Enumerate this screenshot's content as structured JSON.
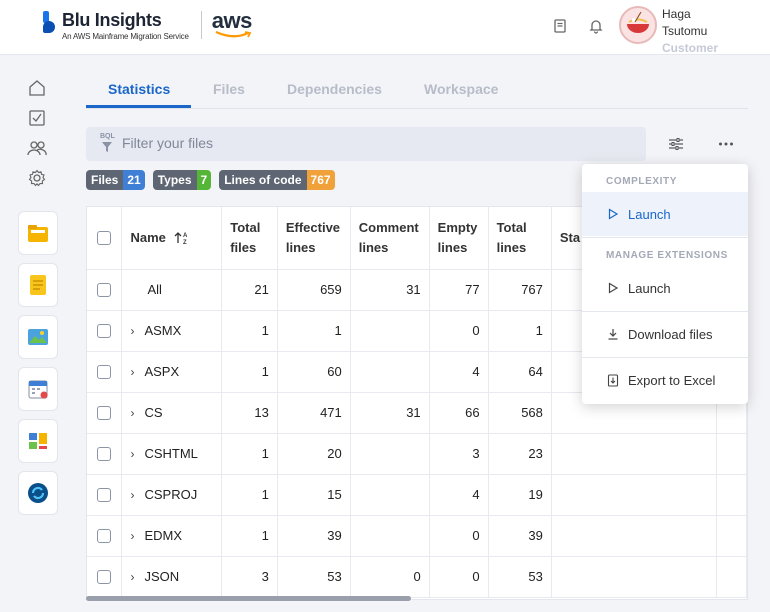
{
  "header": {
    "brand_title": "Blu Insights",
    "brand_subtitle": "An AWS Mainframe Migration Service",
    "aws_label": "aws",
    "user_first": "Haga",
    "user_last": "Tsutomu",
    "user_role": "Customer"
  },
  "tabs": [
    {
      "label": "Statistics",
      "active": true
    },
    {
      "label": "Files",
      "active": false
    },
    {
      "label": "Dependencies",
      "active": false
    },
    {
      "label": "Workspace",
      "active": false
    }
  ],
  "filter": {
    "tag": "BQL",
    "placeholder": "Filter your files"
  },
  "badges": [
    {
      "label": "Files",
      "count": "21",
      "color": "#3f7fd6"
    },
    {
      "label": "Types",
      "count": "7",
      "color": "#55b537"
    },
    {
      "label": "Lines of code",
      "count": "767",
      "color": "#f0a13a"
    }
  ],
  "table": {
    "headers": {
      "name": "Name",
      "total_files": [
        "Total",
        "files"
      ],
      "effective_lines": [
        "Effective",
        "lines"
      ],
      "comment_lines": [
        "Comment",
        "lines"
      ],
      "empty_lines": [
        "Empty",
        "lines"
      ],
      "total_lines": [
        "Total",
        "lines"
      ],
      "status": "Sta"
    },
    "rows": [
      {
        "name": "All",
        "expandable": false,
        "files": "21",
        "effective": "659",
        "comment": "31",
        "empty": "77",
        "total": "767"
      },
      {
        "name": "ASMX",
        "expandable": true,
        "files": "1",
        "effective": "1",
        "comment": "",
        "empty": "0",
        "total": "1"
      },
      {
        "name": "ASPX",
        "expandable": true,
        "files": "1",
        "effective": "60",
        "comment": "",
        "empty": "4",
        "total": "64"
      },
      {
        "name": "CS",
        "expandable": true,
        "files": "13",
        "effective": "471",
        "comment": "31",
        "empty": "66",
        "total": "568"
      },
      {
        "name": "CSHTML",
        "expandable": true,
        "files": "1",
        "effective": "20",
        "comment": "",
        "empty": "3",
        "total": "23"
      },
      {
        "name": "CSPROJ",
        "expandable": true,
        "files": "1",
        "effective": "15",
        "comment": "",
        "empty": "4",
        "total": "19"
      },
      {
        "name": "EDMX",
        "expandable": true,
        "files": "1",
        "effective": "39",
        "comment": "",
        "empty": "0",
        "total": "39"
      },
      {
        "name": "JSON",
        "expandable": true,
        "files": "3",
        "effective": "53",
        "comment": "0",
        "empty": "0",
        "total": "53"
      }
    ]
  },
  "menu": {
    "section_complexity": "COMPLEXITY",
    "complexity_launch": "Launch",
    "section_extensions": "MANAGE EXTENSIONS",
    "extensions_launch": "Launch",
    "download": "Download files",
    "export": "Export to Excel"
  },
  "icons": {
    "sidebar": [
      "home-icon",
      "tasks-icon",
      "users-icon",
      "settings-icon"
    ],
    "apps": [
      "folder-app-icon",
      "notes-app-icon",
      "image-app-icon",
      "calendar-app-icon",
      "dashboard-app-icon",
      "sync-app-icon"
    ]
  },
  "colors": {
    "accent": "#1a66c9",
    "background": "#f3f4f8"
  }
}
